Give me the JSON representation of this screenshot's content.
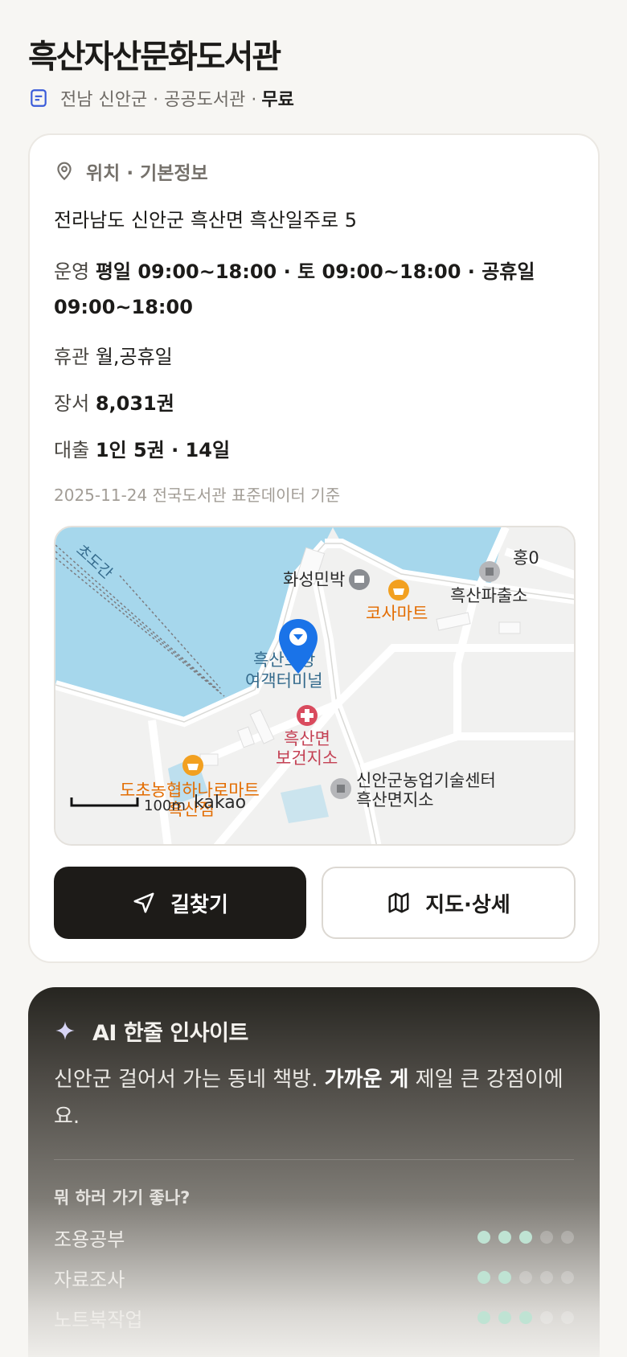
{
  "header": {
    "title": "흑산자산문화도서관",
    "meta": "전남 신안군 · 공공도서관 ·",
    "fee": "무료"
  },
  "info": {
    "section_title": "위치 · 기본정보",
    "address": "전라남도 신안군 흑산면 흑산일주로 5",
    "hours_label": "운영",
    "hours_value": "평일 09:00~18:00 · 토 09:00~18:00 · 공휴일 09:00~18:00",
    "closed_label": "휴관",
    "closed_value": "월,공휴일",
    "books_label": "장서",
    "books_value": "8,031권",
    "loan_label": "대출",
    "loan_value": "1인 5권 · 14일",
    "basis": "2025-11-24 전국도서관 표준데이터 기준"
  },
  "map": {
    "labels": {
      "channel": "초도간",
      "inn": "화성민박",
      "mart": "코사마트",
      "police": "흑산파출소",
      "police_partial": "홍0",
      "terminal_line1": "흑산도항",
      "terminal_line2": "여객터미널",
      "clinic_line1": "흑산면",
      "clinic_line2": "보건지소",
      "agri_line1": "신안군농업기술센터",
      "agri_line2": "흑산면지소",
      "nonghyup": "도초농협하나로마트",
      "nonghyup_line2": "흑산점",
      "scale": "100m",
      "brand": "kakao"
    },
    "colors": {
      "water": "#a6d7ec",
      "land": "#f1f1f0",
      "road": "#ffffff",
      "pin": "#1a73e8"
    }
  },
  "actions": {
    "route_label": "길찾기",
    "map_label": "지도·상세"
  },
  "ai": {
    "title": "AI 한줄 인사이트",
    "text_prefix": "신안군 걸어서 가는 동네 책방. ",
    "text_bold": "가까운 게",
    "text_suffix": " 제일 큰 강점이에요.",
    "question": "뭐 하러 가기 좋나?",
    "activities": [
      {
        "name": "조용공부",
        "score": 3,
        "max": 5
      },
      {
        "name": "자료조사",
        "score": 2,
        "max": 5
      },
      {
        "name": "노트북작업",
        "score": 3,
        "max": 5
      }
    ]
  }
}
